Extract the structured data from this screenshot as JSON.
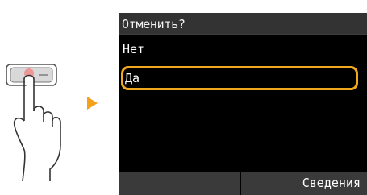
{
  "dialog": {
    "title": "Отменить?",
    "options": [
      {
        "label": "Нет",
        "selected": false
      },
      {
        "label": "Да",
        "selected": true
      }
    ],
    "softkeys": {
      "left": "",
      "right": "Сведения"
    }
  },
  "colors": {
    "selection_border": "#f0a81e",
    "arrow": "#f7a11a",
    "title_bar": "#333333",
    "bottom_bar": "#3a3a3a",
    "screen_bg": "#000000"
  },
  "icons": {
    "hand": "hand-tap-icon",
    "arrow": "arrow-right-icon"
  }
}
